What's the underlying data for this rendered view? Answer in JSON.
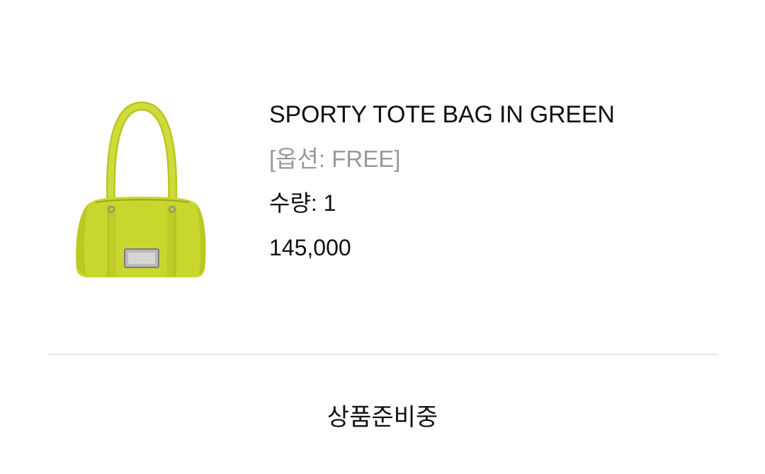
{
  "order_item": {
    "product_name": "SPORTY TOTE BAG IN GREEN",
    "option": "[옵션: FREE]",
    "quantity": "수량: 1",
    "price": "145,000",
    "bag_color": "#c9d62e"
  },
  "status": {
    "label": "상품준비중"
  }
}
